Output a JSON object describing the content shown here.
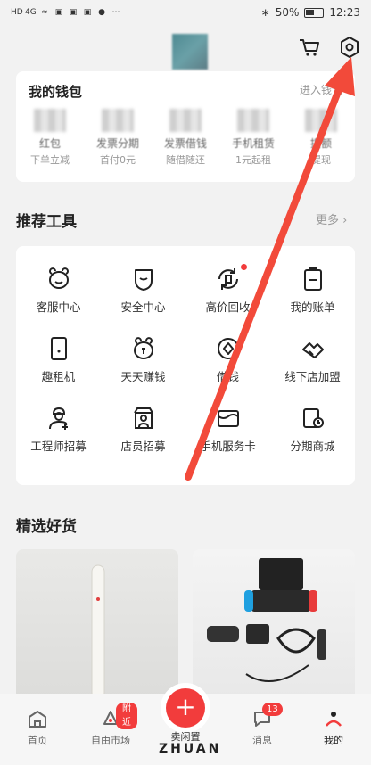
{
  "status_bar": {
    "left_icons": [
      "HD",
      "4G",
      "wifi",
      "app",
      "app",
      "app",
      "chat",
      "more"
    ],
    "battery": "50%",
    "time": "12:23"
  },
  "header": {
    "cart_icon": "cart-icon",
    "settings_icon": "gear-icon"
  },
  "wallet": {
    "title": "我的钱包",
    "enter_link": "进入钱包",
    "items": [
      {
        "name": "红包",
        "sub": "下单立减"
      },
      {
        "name": "发票分期",
        "sub": "首付0元"
      },
      {
        "name": "发票借钱",
        "sub": "随借随还"
      },
      {
        "name": "手机租赁",
        "sub": "1元起租"
      },
      {
        "name": "提额",
        "sub": "提现"
      }
    ]
  },
  "tools": {
    "title": "推荐工具",
    "more": "更多",
    "items": [
      {
        "label": "客服中心",
        "icon": "bear-face-icon"
      },
      {
        "label": "安全中心",
        "icon": "shield-icon"
      },
      {
        "label": "高价回收",
        "icon": "recycle-icon",
        "dot": true
      },
      {
        "label": "我的账单",
        "icon": "bill-icon"
      },
      {
        "label": "趣租机",
        "icon": "phone-icon"
      },
      {
        "label": "天天赚钱",
        "icon": "piggy-icon"
      },
      {
        "label": "借钱",
        "icon": "money-circle-icon"
      },
      {
        "label": "线下店加盟",
        "icon": "handshake-icon"
      },
      {
        "label": "工程师招募",
        "icon": "engineer-icon"
      },
      {
        "label": "店员招募",
        "icon": "clerk-icon"
      },
      {
        "label": "手机服务卡",
        "icon": "card-icon"
      },
      {
        "label": "分期商城",
        "icon": "installment-icon"
      }
    ]
  },
  "goods": {
    "title": "精选好货"
  },
  "bottom_nav": {
    "home": "首页",
    "market": "自由市场",
    "market_badge": "附近",
    "sell": "卖闲置",
    "messages": "消息",
    "messages_badge": "13",
    "mine": "我的"
  },
  "watermark": "ZHUAN",
  "colors": {
    "accent": "#f23c3c",
    "background": "#f2f2f2",
    "card": "#ffffff"
  }
}
